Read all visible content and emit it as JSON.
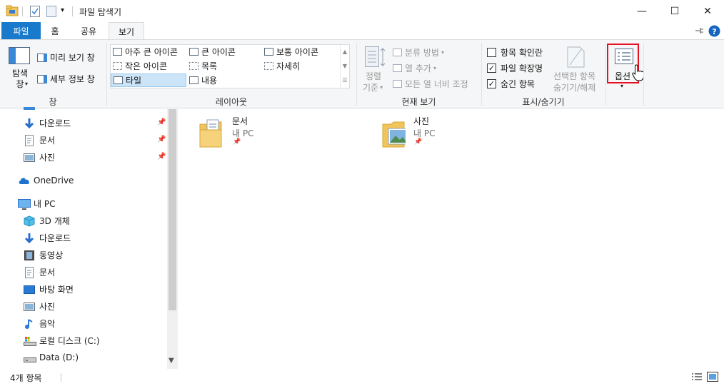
{
  "window": {
    "title": "파일 탐색기",
    "minimize": "—",
    "maximize": "☐",
    "close": "✕",
    "qat_dropdown": "▾"
  },
  "tabs": [
    {
      "label": "파일"
    },
    {
      "label": "홈"
    },
    {
      "label": "공유"
    },
    {
      "label": "보기"
    }
  ],
  "ribbon": {
    "pane": {
      "nav_pane_label": "탐색\n창",
      "preview_pane": "미리 보기 창",
      "details_pane": "세부 정보 창",
      "group_label": "창"
    },
    "layout": {
      "items": [
        "아주 큰 아이콘",
        "큰 아이콘",
        "보통 아이콘",
        "작은 아이콘",
        "목록",
        "자세히",
        "타일",
        "내용"
      ],
      "selected": "타일",
      "group_label": "레이아웃"
    },
    "current_view": {
      "sort_label_1": "정렬",
      "sort_label_2": "기준",
      "group_by": "분류 방법",
      "add_columns": "열 추가",
      "size_all_columns": "모든 열 너비 조정",
      "group_label": "현재 보기"
    },
    "show_hide": {
      "item_checkboxes": "항목 확인란",
      "item_checkboxes_checked": false,
      "file_extensions": "파일 확장명",
      "file_extensions_checked": true,
      "hidden_items": "숨긴 항목",
      "hidden_items_checked": true,
      "hide_selected_1": "선택한 항목",
      "hide_selected_2": "숨기기/해제",
      "group_label": "표시/숨기기"
    },
    "options": {
      "label": "옵션",
      "highlight_color": "#e81123"
    }
  },
  "nav": {
    "items": [
      {
        "label": "다운로드",
        "icon": "download-icon"
      },
      {
        "label": "문서",
        "icon": "document-icon"
      },
      {
        "label": "사진",
        "icon": "pictures-icon"
      },
      {
        "label": "OneDrive",
        "icon": "onedrive-icon"
      },
      {
        "label": "내 PC",
        "icon": "pc-icon"
      },
      {
        "label": "3D 개체",
        "icon": "3d-objects-icon"
      },
      {
        "label": "다운로드",
        "icon": "download-icon"
      },
      {
        "label": "동영상",
        "icon": "video-icon"
      },
      {
        "label": "문서",
        "icon": "document-icon"
      },
      {
        "label": "바탕 화면",
        "icon": "desktop-icon"
      },
      {
        "label": "사진",
        "icon": "pictures-icon"
      },
      {
        "label": "음악",
        "icon": "music-icon"
      },
      {
        "label": "로컬 디스크 (C:)",
        "icon": "local-disk-icon"
      },
      {
        "label": "Data (D:)",
        "icon": "drive-icon"
      }
    ]
  },
  "content": {
    "tiles": [
      {
        "name": "문서",
        "location": "내 PC"
      },
      {
        "name": "사진",
        "location": "내 PC"
      }
    ]
  },
  "status": {
    "count": "4개 항목"
  },
  "colors": {
    "accent": "#1979ca",
    "help": "#1565c0",
    "folder": "#f1c55b"
  }
}
